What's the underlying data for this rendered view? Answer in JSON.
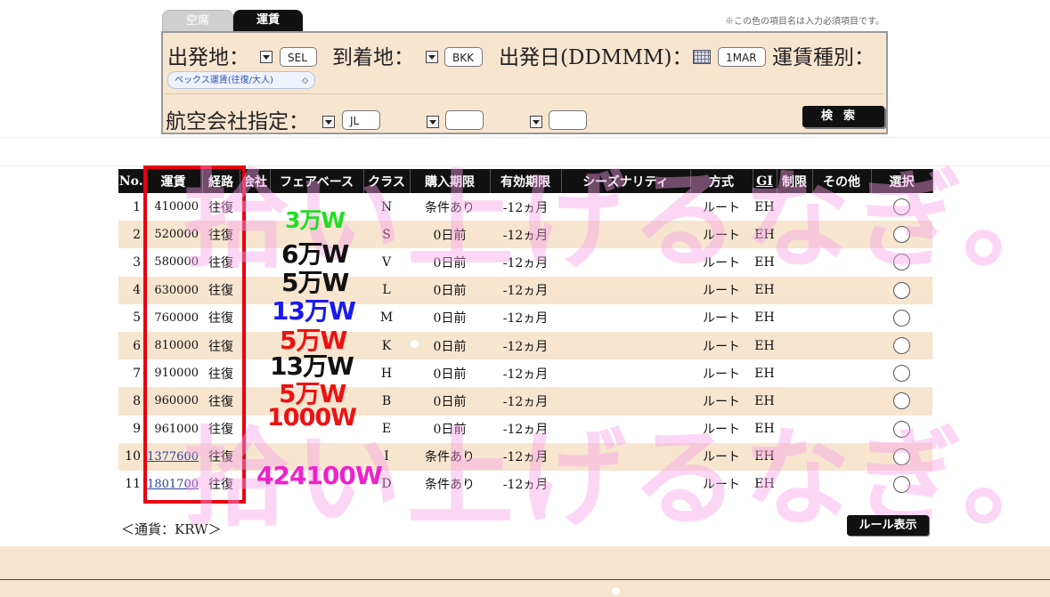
{
  "tabs": [
    {
      "label": "空席"
    },
    {
      "label": "運賃"
    }
  ],
  "required_note": "※この色の項目名は入力必須項目です。",
  "search": {
    "origin_label": "出発地：",
    "origin_value": "SEL",
    "destination_label": "到着地：",
    "destination_value": "BKK",
    "date_label": "出発日(DDMMM)：",
    "date_value": "1MAR",
    "fare_type_label": "運賃種別：",
    "fare_type_value": "ペックス運賃(往復/大人)",
    "airline_label": "航空会社指定：",
    "airline_1": "JL",
    "airline_2": "",
    "airline_3": "",
    "search_button": "検索"
  },
  "table": {
    "headers": [
      "No.",
      "運賃",
      "経路",
      "会社",
      "フェアベース",
      "クラス",
      "購入期限",
      "有効期限",
      "シーズナリティ",
      "方式",
      "GI",
      "制限",
      "その他",
      "選択"
    ],
    "rows": [
      {
        "no": "1",
        "fare": "410000",
        "route": "往復",
        "class": "N",
        "purchase": "条件あり",
        "valid": "-12ヵ月",
        "method": "ルート",
        "gi": "EH"
      },
      {
        "no": "2",
        "fare": "520000",
        "route": "往復",
        "class": "S",
        "purchase": "0日前",
        "valid": "-12ヵ月",
        "method": "ルート",
        "gi": "EH"
      },
      {
        "no": "3",
        "fare": "580000",
        "route": "往復",
        "class": "V",
        "purchase": "0日前",
        "valid": "-12ヵ月",
        "method": "ルート",
        "gi": "EH"
      },
      {
        "no": "4",
        "fare": "630000",
        "route": "往復",
        "class": "L",
        "purchase": "0日前",
        "valid": "-12ヵ月",
        "method": "ルート",
        "gi": "EH"
      },
      {
        "no": "5",
        "fare": "760000",
        "route": "往復",
        "class": "M",
        "purchase": "0日前",
        "valid": "-12ヵ月",
        "method": "ルート",
        "gi": "EH"
      },
      {
        "no": "6",
        "fare": "810000",
        "route": "往復",
        "class": "K",
        "purchase": "0日前",
        "valid": "-12ヵ月",
        "method": "ルート",
        "gi": "EH"
      },
      {
        "no": "7",
        "fare": "910000",
        "route": "往復",
        "class": "H",
        "purchase": "0日前",
        "valid": "-12ヵ月",
        "method": "ルート",
        "gi": "EH"
      },
      {
        "no": "8",
        "fare": "960000",
        "route": "往復",
        "class": "B",
        "purchase": "0日前",
        "valid": "-12ヵ月",
        "method": "ルート",
        "gi": "EH"
      },
      {
        "no": "9",
        "fare": "961000",
        "route": "往復",
        "class": "E",
        "purchase": "0日前",
        "valid": "-12ヵ月",
        "method": "ルート",
        "gi": "EH"
      },
      {
        "no": "10",
        "fare": "1377600",
        "route": "往復",
        "class": "I",
        "purchase": "条件あり",
        "valid": "-12ヵ月",
        "method": "ルート",
        "gi": "EH"
      },
      {
        "no": "11",
        "fare": "1801700",
        "route": "往復",
        "class": "D",
        "purchase": "条件あり",
        "valid": "-12ヵ月",
        "method": "ルート",
        "gi": "EH"
      }
    ]
  },
  "annotations": [
    {
      "text": "3万W",
      "color": "#22dd22"
    },
    {
      "text": "6万W",
      "color": "#111111"
    },
    {
      "text": "5万W",
      "color": "#111111"
    },
    {
      "text": "13万W",
      "color": "#1a1aee"
    },
    {
      "text": "5万W",
      "color": "#ee1111"
    },
    {
      "text": "13万W",
      "color": "#111111"
    },
    {
      "text": "5万W",
      "color": "#ee1111"
    },
    {
      "text": "1000W",
      "color": "#ee1111"
    },
    {
      "text": "424100W",
      "color": "#ee22cc"
    }
  ],
  "watermark": {
    "line1": "拾い上げるなぎ。",
    "line2": "拾い上げるなぎ。"
  },
  "currency_note": "＜通貨：KRW＞",
  "rule_button": "ルール表示"
}
